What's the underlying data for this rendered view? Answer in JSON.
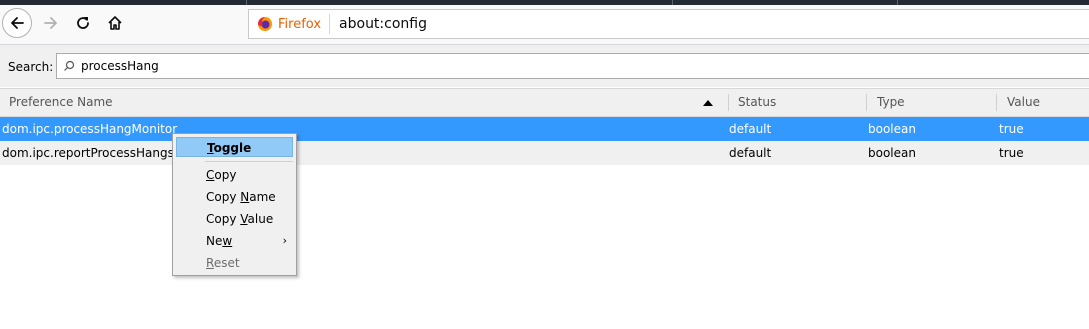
{
  "toolbar": {
    "identity_label": "Firefox",
    "url": "about:config"
  },
  "search": {
    "label": "Search:",
    "value": "processHang"
  },
  "table": {
    "columns": [
      "Preference Name",
      "Status",
      "Type",
      "Value"
    ],
    "rows": [
      {
        "name": "dom.ipc.processHangMonitor",
        "status": "default",
        "type": "boolean",
        "value": "true"
      },
      {
        "name": "dom.ipc.reportProcessHangs",
        "status": "default",
        "type": "boolean",
        "value": "true"
      }
    ]
  },
  "context_menu": {
    "toggle": {
      "pre": "",
      "key": "T",
      "post": "oggle"
    },
    "copy": {
      "pre": "",
      "key": "C",
      "post": "opy"
    },
    "copy_name": {
      "pre": "Copy ",
      "key": "N",
      "post": "ame"
    },
    "copy_value": {
      "pre": "Copy ",
      "key": "V",
      "post": "alue"
    },
    "new": {
      "pre": "Ne",
      "key": "w",
      "post": ""
    },
    "reset": {
      "pre": "",
      "key": "R",
      "post": "eset"
    }
  },
  "colors": {
    "selection": "#3399ff",
    "menu_highlight": "#91c9f7",
    "identity_orange": "#e66000"
  }
}
